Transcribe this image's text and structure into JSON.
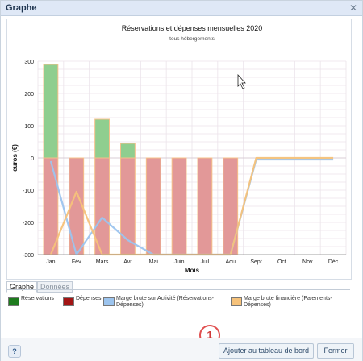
{
  "window": {
    "title": "Graphe",
    "close_icon": "close-icon"
  },
  "chart_data": {
    "type": "bar",
    "title": "Réservations et dépenses mensuelles 2020",
    "subtitle": "tous hébergements",
    "xlabel": "Mois",
    "ylabel": "euros (€)",
    "ylim": [
      -300,
      300
    ],
    "yticks": [
      300,
      200,
      100,
      0,
      -100,
      -200,
      -300
    ],
    "categories": [
      "Jan",
      "Fév",
      "Mars",
      "Avr",
      "Mai",
      "Juin",
      "Juil",
      "Aou",
      "Sept",
      "Oct",
      "Nov",
      "Déc"
    ],
    "stacked": true,
    "series": [
      {
        "name": "Réservations",
        "kind": "bar",
        "color": "#8fce8f",
        "edge": "#f5c08a",
        "values": [
          290,
          0,
          120,
          45,
          0,
          0,
          0,
          0,
          0,
          0,
          0,
          0
        ]
      },
      {
        "name": "Dépenses",
        "kind": "bar",
        "color": "#e29898",
        "edge": "#f5c08a",
        "values": [
          -300,
          -300,
          -300,
          -300,
          -300,
          -300,
          -300,
          -300,
          0,
          0,
          0,
          0
        ]
      },
      {
        "name": "Marge brute sur Activité (Réservations-Dépenses)",
        "kind": "line",
        "color": "#9cc4ee",
        "values": [
          -10,
          -300,
          -185,
          -255,
          -300,
          -300,
          -300,
          -300,
          -5,
          -5,
          -5,
          -5
        ]
      },
      {
        "name": "Marge brute financière (Paiements-Dépenses)",
        "kind": "line",
        "color": "#f6c27a",
        "values": [
          -300,
          -105,
          -300,
          -300,
          -300,
          -300,
          -300,
          -300,
          0,
          0,
          0,
          0
        ]
      }
    ],
    "grid": true,
    "legend_position": "bottom"
  },
  "tabs": [
    {
      "label": "Graphe",
      "active": true
    },
    {
      "label": "Données",
      "active": false
    }
  ],
  "legend": [
    {
      "label": "Réservations",
      "color": "#1e7b1e"
    },
    {
      "label": "Dépenses",
      "color": "#a31515"
    },
    {
      "label": "Marge brute sur Activité (Réservations-Dépenses)",
      "color": "#9cc4ee"
    },
    {
      "label": "Marge brute financière (Paiements-Dépenses)",
      "color": "#f6c27a"
    }
  ],
  "footer": {
    "help_label": "?",
    "add_label": "Ajouter au tableau de bord",
    "close_label": "Fermer",
    "marker_label": "1"
  }
}
